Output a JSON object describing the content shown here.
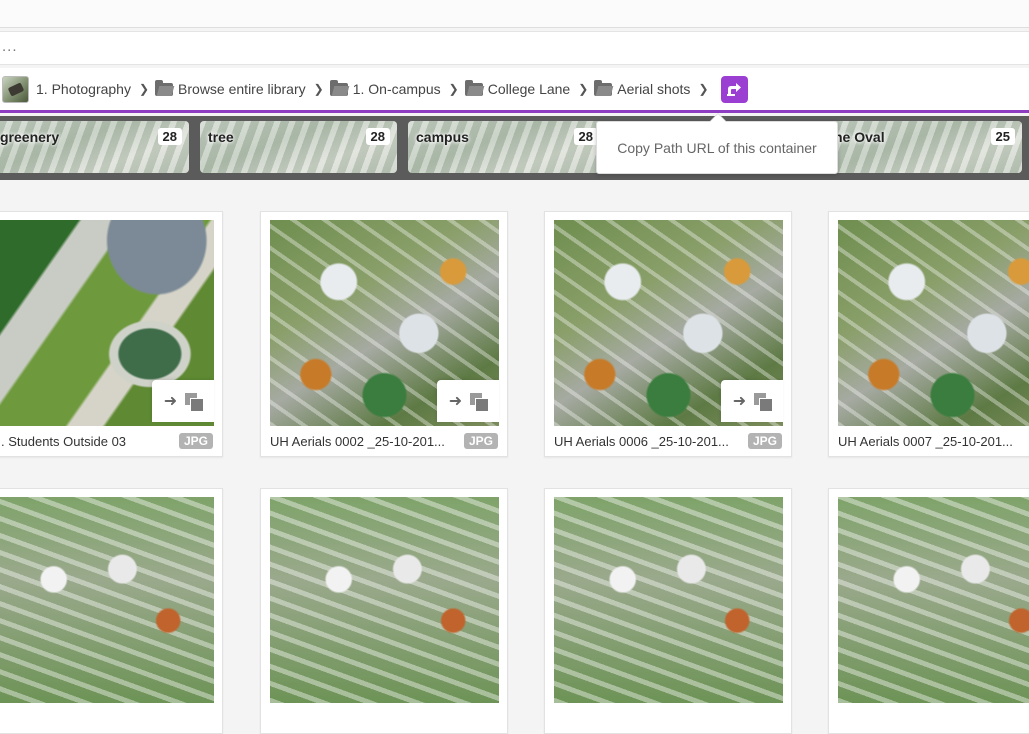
{
  "search": {
    "text": "..."
  },
  "breadcrumb": {
    "items": [
      {
        "label": "1. Photography",
        "icon": "thumbnail"
      },
      {
        "label": "Browse entire library",
        "icon": "folder-icon"
      },
      {
        "label": "1. On-campus",
        "icon": "folder-icon"
      },
      {
        "label": "College Lane",
        "icon": "folder-icon"
      },
      {
        "label": "Aerial shots",
        "icon": "folder-icon"
      }
    ],
    "separator": "❯",
    "copy_button_icon": "share-link-icon",
    "accent": "#9b3fd3"
  },
  "tooltip": {
    "text": "Copy Path URL of this container"
  },
  "tags": [
    {
      "label": "greenery",
      "count": "28"
    },
    {
      "label": "tree",
      "count": "28"
    },
    {
      "label": "campus",
      "count": "28"
    },
    {
      "label": "he Oval",
      "count": "25"
    }
  ],
  "cards": [
    {
      "name": ". Students Outside 03",
      "type": "JPG"
    },
    {
      "name": "UH Aerials 0002 _25-10-201...",
      "type": "JPG"
    },
    {
      "name": "UH Aerials 0006 _25-10-201...",
      "type": "JPG"
    },
    {
      "name": "UH Aerials 0007 _25-10-201...",
      "type": ""
    }
  ],
  "card_actions": {
    "move_icon": "arrow-right-icon",
    "duplicate_icon": "duplicate-icon"
  }
}
